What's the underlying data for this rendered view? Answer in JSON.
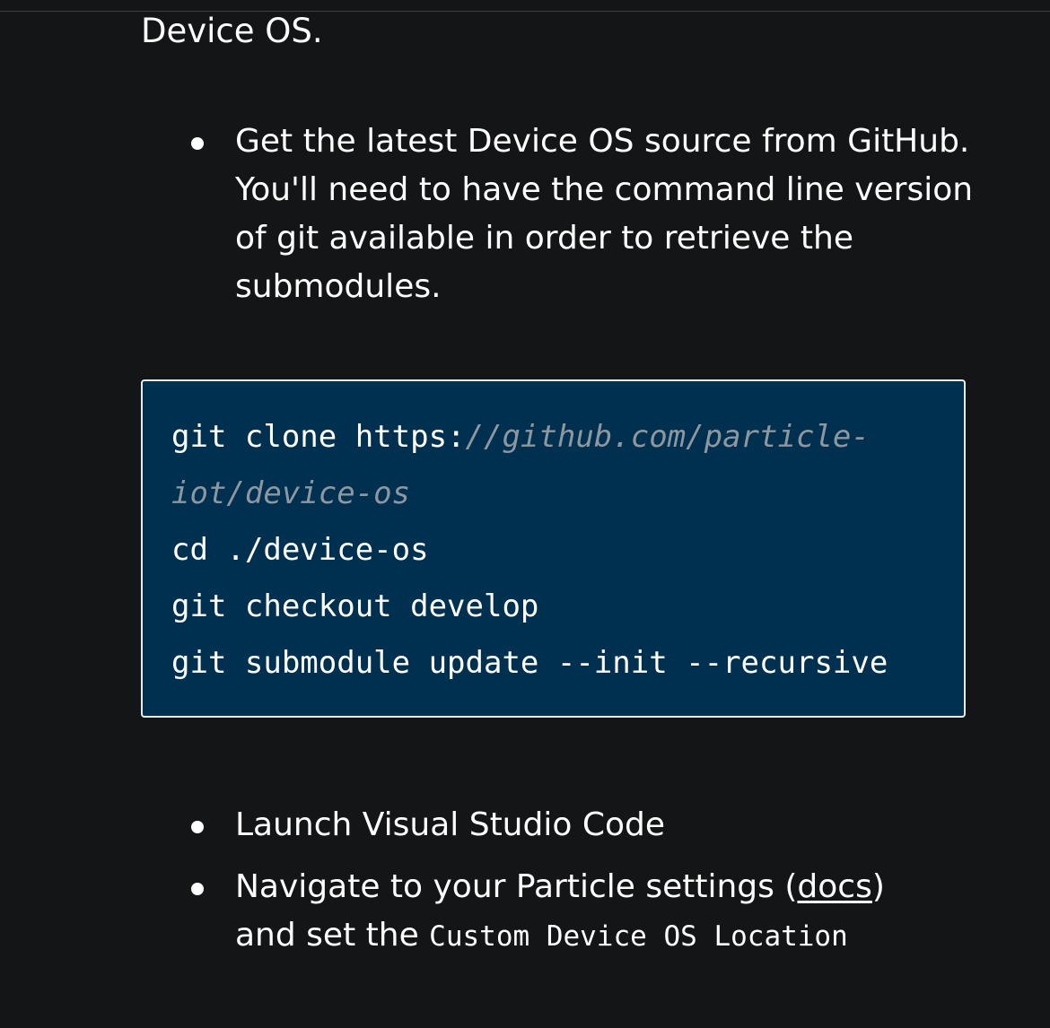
{
  "intro": {
    "tail_text": "Device OS."
  },
  "steps_top": [
    {
      "text": "Get the latest Device OS source from GitHub. You'll need to have the command line version of git available in order to retrieve the submodules."
    }
  ],
  "code_block": {
    "line1_cmd": "git clone https:",
    "line1_comment": "//github.com/particle-",
    "line2_comment": "iot/device-os",
    "line3": "cd ./device-os",
    "line4": "git checkout develop",
    "line5": "git submodule update --init --recursive"
  },
  "steps_bottom": {
    "launch": "Launch Visual Studio Code",
    "navigate_prefix": "Navigate to your Particle settings (",
    "docs_link": "docs",
    "navigate_suffix": ")",
    "set_prefix": "and set the ",
    "setting_name": "Custom Device OS Location"
  },
  "colors": {
    "background": "#141517",
    "code_background": "#003050",
    "code_border": "#e8ecef",
    "comment": "#8d97a0"
  }
}
